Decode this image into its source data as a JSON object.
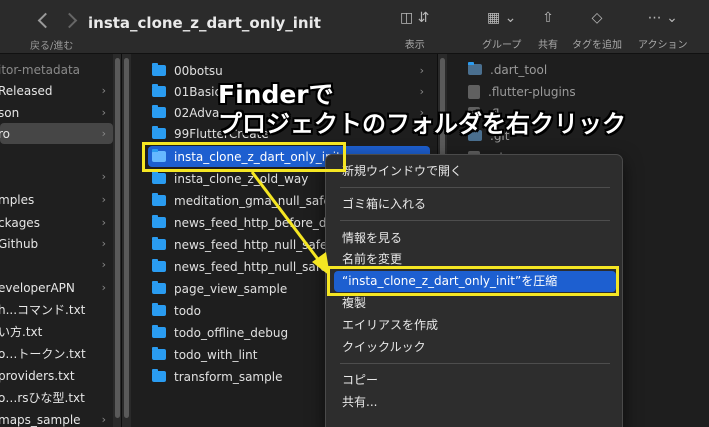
{
  "toolbar": {
    "nav_label": "戻る/進む",
    "window_title": "insta_clone_z_dart_only_init",
    "view_label": "表示",
    "group_label": "グループ",
    "share_label": "共有",
    "tags_label": "タグを追加",
    "action_label": "アクション"
  },
  "column1": {
    "items": [
      {
        "label": "itor-metadata",
        "chevron": ""
      },
      {
        "label": "Released",
        "chevron": "›"
      },
      {
        "label": "son",
        "chevron": "›"
      },
      {
        "label": "ro",
        "chevron": "›"
      },
      {
        "label": "",
        "chevron": "›"
      },
      {
        "label": "mples",
        "chevron": "›"
      },
      {
        "label": "ckages",
        "chevron": "›"
      },
      {
        "label": "Github",
        "chevron": "›"
      },
      {
        "label": "",
        "chevron": "›"
      },
      {
        "label": "eveloperAPN",
        "chevron": "›"
      },
      {
        "label": "h...コマンド.txt",
        "chevron": ""
      },
      {
        "label": "い方.txt",
        "chevron": ""
      },
      {
        "label": "o…トークン.txt",
        "chevron": ""
      },
      {
        "label": "providers.txt",
        "chevron": ""
      },
      {
        "label": "o…rsひな型.txt",
        "chevron": ""
      },
      {
        "label": "maps_sample",
        "chevron": "›"
      }
    ]
  },
  "column2": {
    "items": [
      {
        "label": "00botsu"
      },
      {
        "label": "01Basic"
      },
      {
        "label": "02Adva"
      },
      {
        "label": "99FlutterCreate"
      },
      {
        "label": "insta_clone_z_dart_only_init"
      },
      {
        "label": "insta_clone_z_old_way"
      },
      {
        "label": "meditation_gma_null_safet"
      },
      {
        "label": "news_feed_http_before_di"
      },
      {
        "label": "news_feed_http_null_safet"
      },
      {
        "label": "news_feed_http_null_safet"
      },
      {
        "label": "page_view_sample"
      },
      {
        "label": "todo"
      },
      {
        "label": "todo_offline_debug"
      },
      {
        "label": "todo_with_lint"
      },
      {
        "label": "transform_sample"
      }
    ]
  },
  "column3": {
    "items": [
      {
        "label": ".dart_tool"
      },
      {
        "label": ".flutter-plugins"
      },
      {
        "label": ".fl"
      },
      {
        "label": ".git"
      },
      {
        "label": ".gi"
      }
    ]
  },
  "context_menu": {
    "items": [
      {
        "label": "新規ウインドウで開く"
      },
      {
        "label": "ゴミ箱に入れる"
      },
      {
        "label": "情報を見る"
      },
      {
        "label": "名前を変更"
      },
      {
        "label": "“insta_clone_z_dart_only_init”を圧縮"
      },
      {
        "label": "複製"
      },
      {
        "label": "エイリアスを作成"
      },
      {
        "label": "クイックルック"
      },
      {
        "label": "コピー"
      },
      {
        "label": "共有..."
      }
    ]
  },
  "annotation": {
    "line1": "Finderで",
    "line2": "プロジェクトのフォルダを右クリック"
  },
  "colors": {
    "highlight": "#f5e623",
    "selection": "#1d5fd0",
    "folder": "#2a9cf1"
  }
}
